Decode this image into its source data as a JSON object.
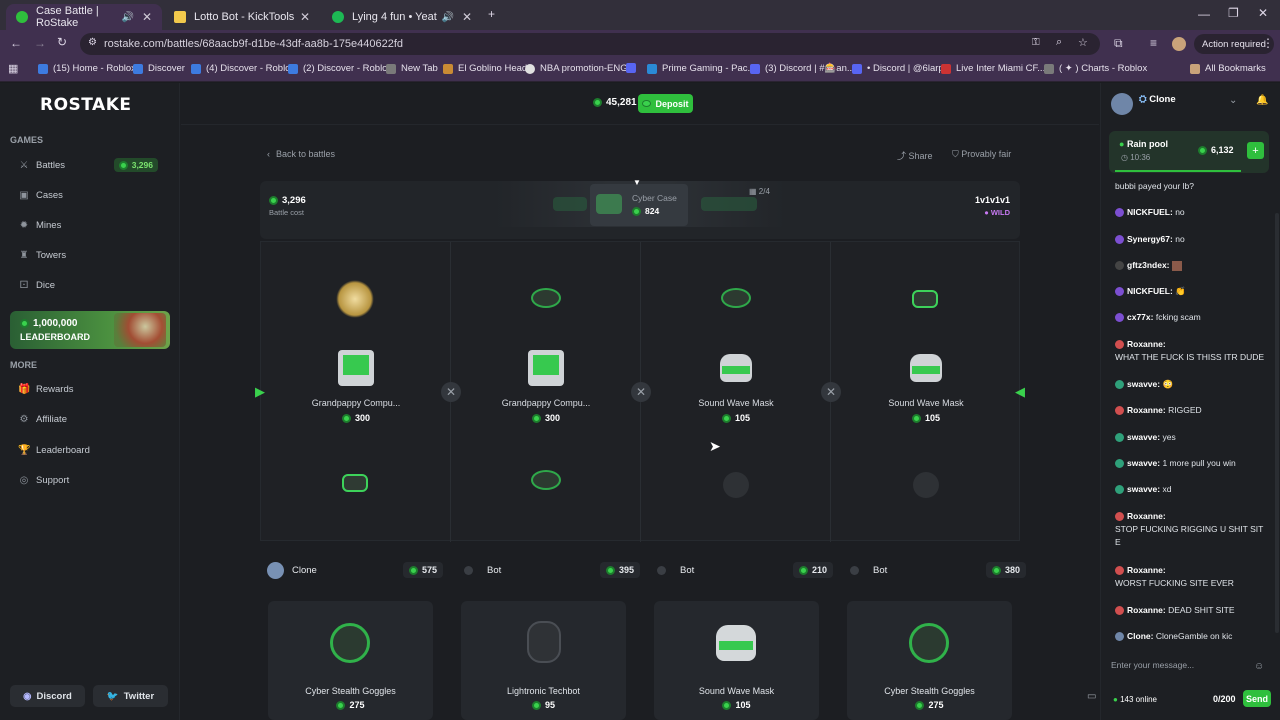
{
  "browser": {
    "tabs": [
      {
        "title": "Case Battle | RoStake",
        "active": true
      },
      {
        "title": "Lotto Bot - KickTools",
        "active": false
      },
      {
        "title": "Lying 4 fun • Yeat",
        "active": false
      }
    ],
    "url": "rostake.com/battles/68aacb9f-d1be-43df-aa8b-175e440622fd",
    "action_required": "Action required",
    "bookmarks": [
      "(15) Home - Roblox",
      "Discover",
      "(4) Discover - Roblox",
      "(2) Discover - Roblox",
      "New Tab",
      "El Goblino Head",
      "NBA promotion-ENG",
      "Prime Gaming - Pac...",
      "(3) Discord | #🎰an...",
      "• Discord | @6larp",
      "Live Inter Miami CF...",
      "( ✦ ) Charts - Roblox",
      "All Bookmarks"
    ]
  },
  "sidebar": {
    "logo": "ROSTAKE",
    "games_heading": "GAMES",
    "games": [
      {
        "label": "Battles",
        "badge": "3,296"
      },
      {
        "label": "Cases"
      },
      {
        "label": "Mines"
      },
      {
        "label": "Towers"
      },
      {
        "label": "Dice"
      }
    ],
    "leaderboard_banner": {
      "amount": "1,000,000",
      "label": "LEADERBOARD"
    },
    "more_heading": "MORE",
    "more": [
      {
        "label": "Rewards"
      },
      {
        "label": "Affiliate"
      },
      {
        "label": "Leaderboard"
      },
      {
        "label": "Support"
      }
    ],
    "discord": "Discord",
    "twitter": "Twitter"
  },
  "topbar": {
    "balance": "45,281",
    "deposit": "Deposit"
  },
  "battle": {
    "back": "Back to battles",
    "share": "Share",
    "provably_fair": "Provably fair",
    "cost": "3,296",
    "cost_label": "Battle cost",
    "case_name": "Cyber Case",
    "case_price": "824",
    "round": "2/4",
    "mode": "1v1v1v1",
    "mode_tag": "WILD"
  },
  "arena": {
    "columns": [
      {
        "name": "Grandpappy Compu...",
        "price": "300"
      },
      {
        "name": "Grandpappy Compu...",
        "price": "300"
      },
      {
        "name": "Sound Wave Mask",
        "price": "105"
      },
      {
        "name": "Sound Wave Mask",
        "price": "105"
      }
    ]
  },
  "players": [
    {
      "name": "Clone",
      "value": "575"
    },
    {
      "name": "Bot",
      "value": "395"
    },
    {
      "name": "Bot",
      "value": "210"
    },
    {
      "name": "Bot",
      "value": "380"
    }
  ],
  "cards": [
    {
      "name": "Cyber Stealth Goggles",
      "price": "275"
    },
    {
      "name": "Lightronic Techbot",
      "price": "95"
    },
    {
      "name": "Sound Wave Mask",
      "price": "105"
    },
    {
      "name": "Cyber Stealth Goggles",
      "price": "275"
    }
  ],
  "chat": {
    "user": "Clone",
    "rain_label": "Rain pool",
    "rain_timer": "10:36",
    "rain_amount": "6,132",
    "messages": [
      {
        "user": "",
        "text": "bubbi payed your lb?"
      },
      {
        "user": "NICKFUEL:",
        "text": "no"
      },
      {
        "user": "Synergy67:",
        "text": "no"
      },
      {
        "user": "gftz3ndex:",
        "text": ""
      },
      {
        "user": "NICKFUEL:",
        "text": "👏"
      },
      {
        "user": "cx77x:",
        "text": "fcking scam"
      },
      {
        "user": "Roxanne:",
        "text": "WHAT THE FUCK IS THISS ITR DUDE"
      },
      {
        "user": "swavve:",
        "text": "😳"
      },
      {
        "user": "Roxanne:",
        "text": "RIGGED"
      },
      {
        "user": "swavve:",
        "text": "yes"
      },
      {
        "user": "swavve:",
        "text": "1 more pull you win"
      },
      {
        "user": "swavve:",
        "text": "xd"
      },
      {
        "user": "Roxanne:",
        "text": "STOP FUCKING RIGGING U SHIT SIT E"
      },
      {
        "user": "Roxanne:",
        "text": "WORST FUCKING SITE EVER"
      },
      {
        "user": "Roxanne:",
        "text": "DEAD SHIT SITE"
      },
      {
        "user": "Clone:",
        "text": "CloneGamble on kic"
      }
    ],
    "input_placeholder": "Enter your message...",
    "online": "143 online",
    "char_count": "0/200",
    "send": "Send"
  },
  "colors": {
    "accent_green": "#2fbf3d",
    "bg": "#1c1e22",
    "browser": "#40304f"
  }
}
